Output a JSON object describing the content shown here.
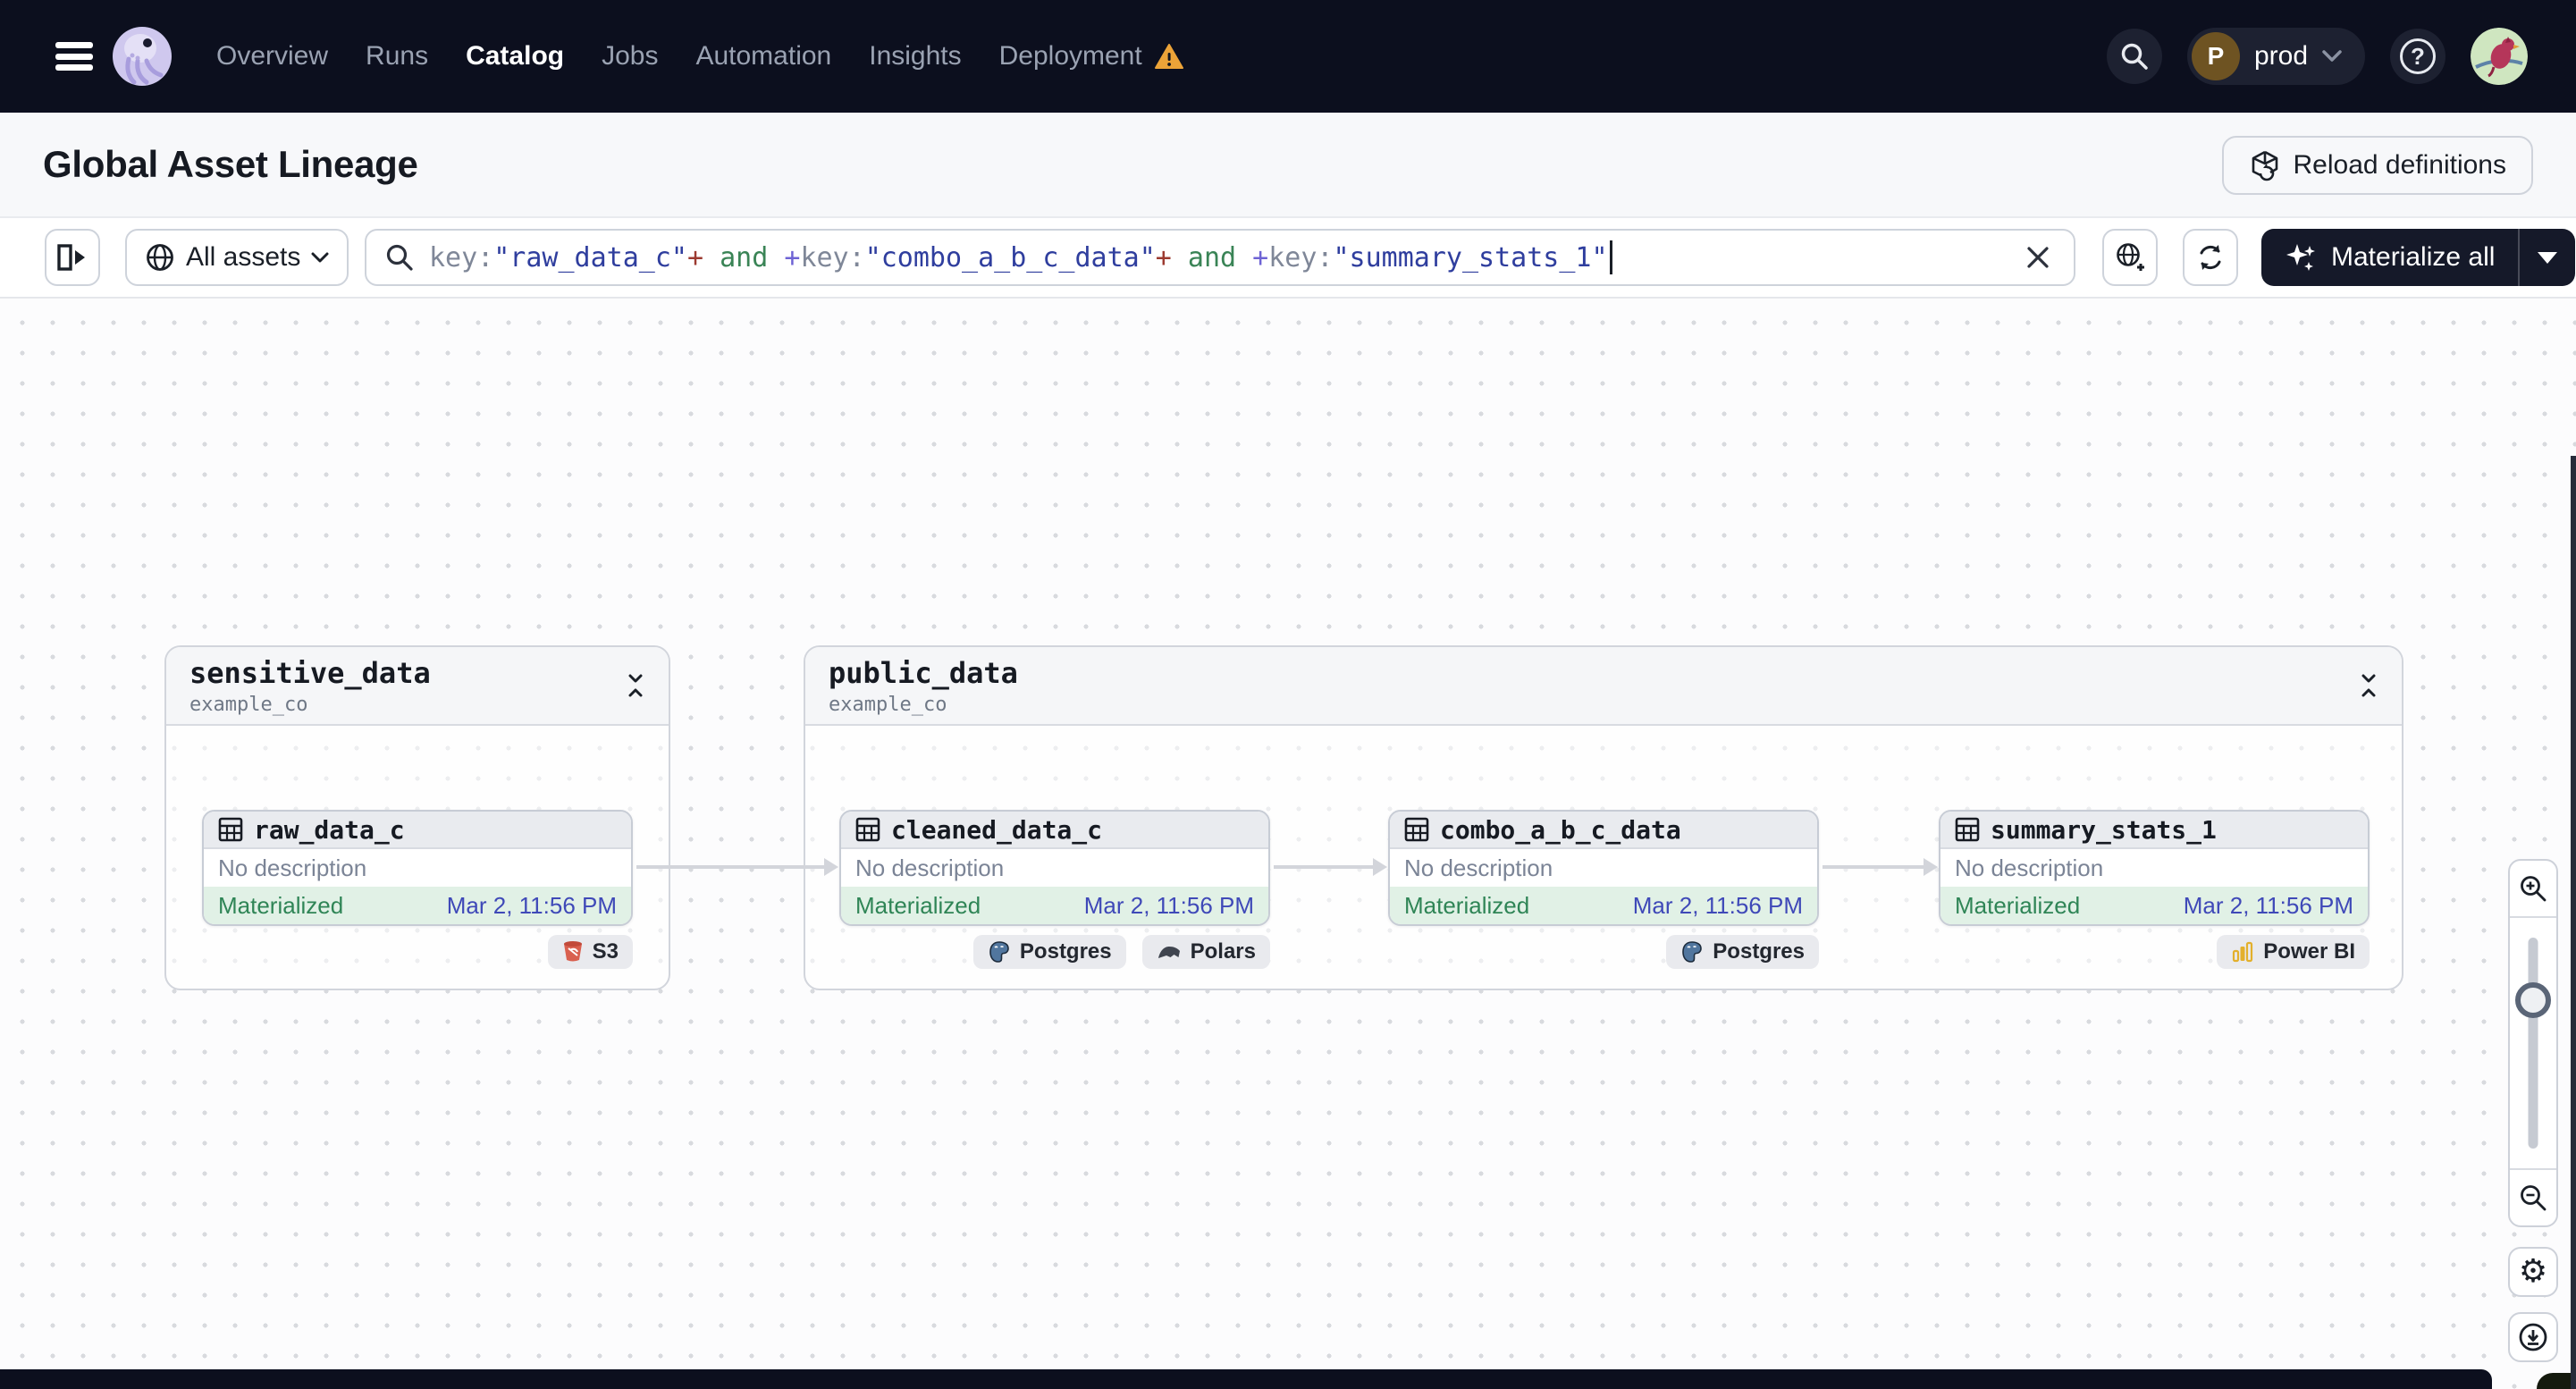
{
  "nav": {
    "items": [
      {
        "label": "Overview"
      },
      {
        "label": "Runs"
      },
      {
        "label": "Catalog"
      },
      {
        "label": "Jobs"
      },
      {
        "label": "Automation"
      },
      {
        "label": "Insights"
      },
      {
        "label": "Deployment"
      }
    ],
    "environment": {
      "initial": "P",
      "label": "prod"
    }
  },
  "header": {
    "title": "Global Asset Lineage",
    "reload_label": "Reload definitions"
  },
  "toolbar": {
    "scope_label": "All assets",
    "materialize_label": "Materialize all",
    "query": {
      "parts": [
        {
          "text": "key:"
        },
        {
          "text": "\"raw_data_c\""
        },
        {
          "text": "+"
        },
        {
          "text": " and "
        },
        {
          "text": "+"
        },
        {
          "text": "key:"
        },
        {
          "text": "\"combo_a_b_c_data\""
        },
        {
          "text": "+"
        },
        {
          "text": " and "
        },
        {
          "text": "+"
        },
        {
          "text": "key:"
        },
        {
          "text": "\"summary_stats_1\""
        }
      ]
    }
  },
  "graph": {
    "groups": [
      {
        "name": "sensitive_data",
        "location": "example_co"
      },
      {
        "name": "public_data",
        "location": "example_co"
      }
    ],
    "nodes": [
      {
        "name": "raw_data_c",
        "description": "No description",
        "status": "Materialized",
        "timestamp": "Mar 2, 11:56 PM",
        "badges": [
          {
            "label": "S3"
          }
        ]
      },
      {
        "name": "cleaned_data_c",
        "description": "No description",
        "status": "Materialized",
        "timestamp": "Mar 2, 11:56 PM",
        "badges": [
          {
            "label": "Postgres"
          },
          {
            "label": "Polars"
          }
        ]
      },
      {
        "name": "combo_a_b_c_data",
        "description": "No description",
        "status": "Materialized",
        "timestamp": "Mar 2, 11:56 PM",
        "badges": [
          {
            "label": "Postgres"
          }
        ]
      },
      {
        "name": "summary_stats_1",
        "description": "No description",
        "status": "Materialized",
        "timestamp": "Mar 2, 11:56 PM",
        "badges": [
          {
            "label": "Power BI"
          }
        ]
      }
    ]
  },
  "colors": {
    "nav_bg": "#0c0f1e",
    "status_green": "#2f8556",
    "timestamp_indigo": "#3f49b8",
    "warning_orange": "#eca338",
    "materialize_bg": "#151929"
  }
}
